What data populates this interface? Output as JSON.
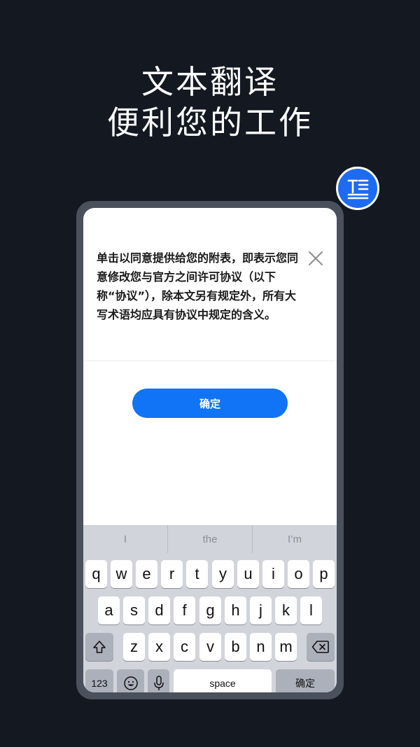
{
  "headline": {
    "line1": "文本翻译",
    "line2": "便利您的工作"
  },
  "dialog": {
    "message": "单击以同意提供给您的附表，即表示您同意修改您与官方之间许可协议（以下称“协议”），除本文另有规定外，所有大写术语均应具有协议中规定的含义。",
    "confirm_label": "确定"
  },
  "keyboard": {
    "suggestions": [
      "I",
      "the",
      "I’m"
    ],
    "row1": [
      "q",
      "w",
      "e",
      "r",
      "t",
      "y",
      "u",
      "i",
      "o",
      "p"
    ],
    "row2": [
      "a",
      "s",
      "d",
      "f",
      "g",
      "h",
      "j",
      "k",
      "l"
    ],
    "row3": [
      "z",
      "x",
      "c",
      "v",
      "b",
      "n",
      "m"
    ],
    "numbers_label": "123",
    "space_label": "space",
    "return_label": "确定"
  },
  "colors": {
    "background": "#141821",
    "accent": "#1173F5",
    "badge": "#1E6BF3"
  }
}
